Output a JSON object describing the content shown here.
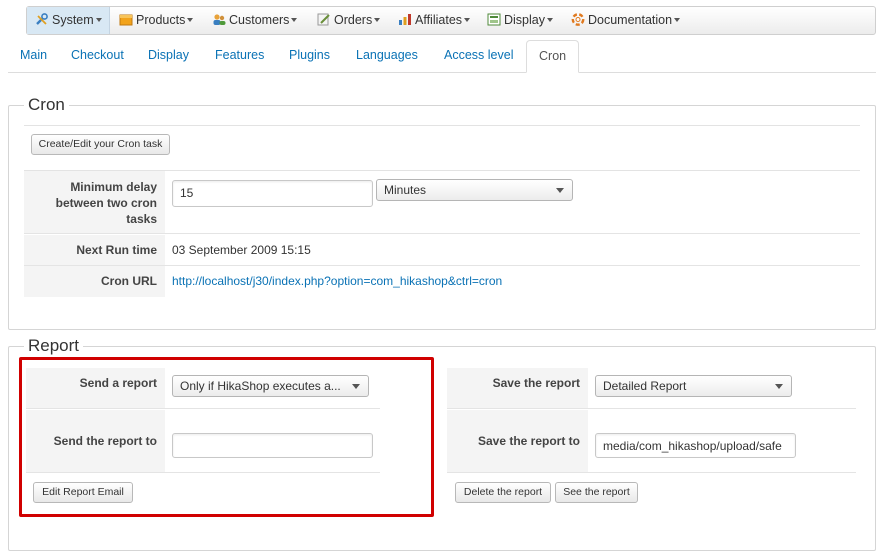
{
  "menu": {
    "items": [
      {
        "label": "System",
        "icon": "wrench-icon"
      },
      {
        "label": "Products",
        "icon": "box-icon"
      },
      {
        "label": "Customers",
        "icon": "users-icon"
      },
      {
        "label": "Orders",
        "icon": "pen-icon"
      },
      {
        "label": "Affiliates",
        "icon": "affiliates-icon"
      },
      {
        "label": "Display",
        "icon": "display-icon"
      },
      {
        "label": "Documentation",
        "icon": "lifebuoy-icon"
      }
    ]
  },
  "tabs": [
    "Main",
    "Checkout",
    "Display",
    "Features",
    "Plugins",
    "Languages",
    "Access level",
    "Cron"
  ],
  "cron": {
    "legend": "Cron",
    "create_button": "Create/Edit your Cron task",
    "min_delay_label": "Minimum delay between two cron tasks",
    "min_delay_value": "15",
    "unit_value": "Minutes",
    "next_run_label": "Next Run time",
    "next_run_value": "03 September 2009 15:15",
    "url_label": "Cron URL",
    "url_value": "http://localhost/j30/index.php?option=com_hikashop&ctrl=cron"
  },
  "report": {
    "legend": "Report",
    "send_label": "Send a report",
    "send_value": "Only if HikaShop executes a...",
    "send_to_label": "Send the report to",
    "send_to_value": "",
    "edit_email_button": "Edit Report Email",
    "save_label": "Save the report",
    "save_value": "Detailed Report",
    "save_to_label": "Save the report to",
    "save_to_value": "media/com_hikashop/upload/safe",
    "delete_button": "Delete the report",
    "see_button": "See the report"
  },
  "colors": {
    "link": "#0a72b5",
    "highlight": "#d00000",
    "active_menu": "#d8e8f4"
  }
}
